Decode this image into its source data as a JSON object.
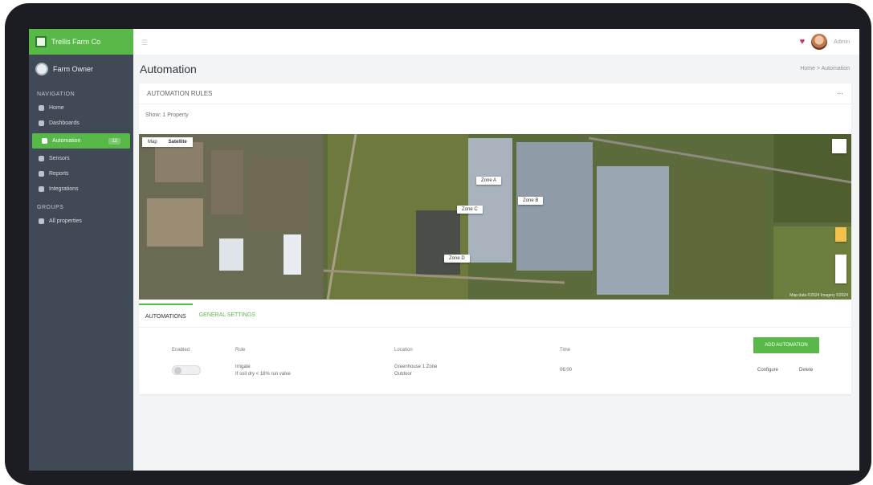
{
  "app": {
    "brand": "Trellis Farm Co",
    "user": "Farm Owner",
    "topbar_user": "Admin"
  },
  "sidebar": {
    "section_main": "NAVIGATION",
    "items": [
      {
        "label": "Home"
      },
      {
        "label": "Dashboards"
      },
      {
        "label": "Automation",
        "badge": "12",
        "active": true
      },
      {
        "label": "Sensors"
      },
      {
        "label": "Reports"
      },
      {
        "label": "Integrations"
      }
    ],
    "section_other": "GROUPS",
    "group_item": "All properties"
  },
  "header": {
    "title": "Automation",
    "breadcrumb": "Home > Automation"
  },
  "card": {
    "title": "AUTOMATION RULES",
    "menu": "⋯",
    "filter": "Show: 1 Property"
  },
  "map": {
    "types": [
      "Map",
      "Satellite"
    ],
    "pins": [
      "Zone A",
      "Zone B",
      "Zone C",
      "Zone D"
    ],
    "attribution": "Map data ©2024 Imagery ©2024"
  },
  "tabs": [
    "AUTOMATIONS",
    "GENERAL SETTINGS"
  ],
  "table": {
    "headers": [
      "Enabled",
      "Rule",
      "Location",
      "Time"
    ],
    "add_button": "ADD AUTOMATION",
    "rows": [
      {
        "rule_title": "Irrigate",
        "rule_sub": "If soil dry < 18% run valve",
        "location": "Greenhouse 1 Zone",
        "location_sub": "Outdoor",
        "time": "06:00",
        "edit": "Configure",
        "delete": "Delete"
      }
    ]
  },
  "colors": {
    "brand": "#58b948",
    "sidebar": "#3f4a56"
  }
}
